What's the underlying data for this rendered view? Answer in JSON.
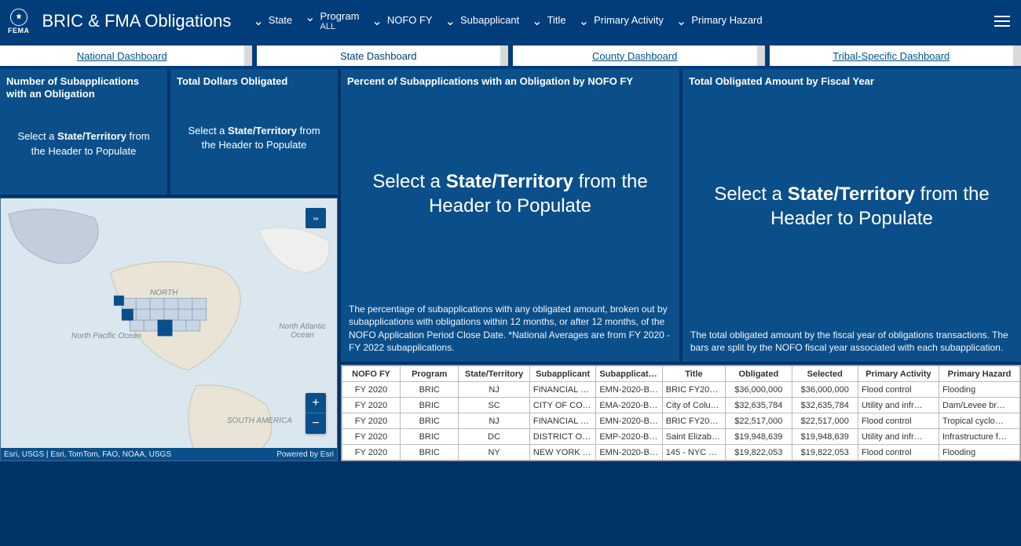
{
  "header": {
    "logo_text": "FEMA",
    "title": "BRIC & FMA Obligations",
    "filters": [
      {
        "label": "State",
        "value": ""
      },
      {
        "label": "Program",
        "value": "ALL"
      },
      {
        "label": "NOFO FY",
        "value": ""
      },
      {
        "label": "Subapplicant",
        "value": ""
      },
      {
        "label": "Title",
        "value": ""
      },
      {
        "label": "Primary Activity",
        "value": ""
      },
      {
        "label": "Primary Hazard",
        "value": ""
      }
    ]
  },
  "tabs": [
    {
      "label": "National Dashboard",
      "active": false
    },
    {
      "label": "State Dashboard",
      "active": true
    },
    {
      "label": "County Dashboard",
      "active": false
    },
    {
      "label": "Tribal-Specific Dashboard",
      "active": false
    }
  ],
  "cards": {
    "num_subapps": {
      "title": "Number of Subapplications with an Obligation",
      "placeholder_pre": "Select a ",
      "placeholder_bold": "State/Territory",
      "placeholder_post": " from the Header to Populate"
    },
    "total_dollars": {
      "title": "Total Dollars Obligated",
      "placeholder_pre": "Select a ",
      "placeholder_bold": "State/Territory",
      "placeholder_post": " from the Header to Populate"
    },
    "percent_nofo": {
      "title": "Percent of Subapplications with an Obligation by NOFO FY",
      "placeholder_pre": "Select a ",
      "placeholder_bold": "State/Territory",
      "placeholder_post": " from the Header to Populate",
      "desc": "The percentage of subapplications with any obligated amount, broken out by subapplications with obligations within 12 months, or after 12 months, of the NOFO Application Period Close Date. *National Averages are from FY 2020 - FY 2022 subapplications."
    },
    "total_by_fy": {
      "title": "Total Obligated Amount by Fiscal Year",
      "placeholder_pre": "Select a ",
      "placeholder_bold": "State/Territory",
      "placeholder_post": " from the Header to Populate",
      "desc": "The total obligated amount by the fiscal year of obligations transactions. The bars are split by the NOFO fiscal year associated with each subapplication."
    }
  },
  "map": {
    "labels": {
      "north_america": "NORTH",
      "south_america": "SOUTH AMERICA",
      "pacific": "North Pacific Ocean",
      "atlantic": "North Atlantic Ocean"
    },
    "attribution_left": "Esri, USGS | Esri, TomTom, FAO, NOAA, USGS",
    "attribution_right": "Powered by Esri"
  },
  "table": {
    "columns": [
      "NOFO FY",
      "Program",
      "State/Territory",
      "Subapplicant",
      "Subapplicatio…",
      "Title",
      "Obligated",
      "Selected",
      "Primary Activity",
      "Primary Hazard"
    ],
    "rows": [
      [
        "FY 2020",
        "BRIC",
        "NJ",
        "FINANCIAL M…",
        "EMN-2020-BR…",
        "BRIC FY2020 …",
        "$36,000,000",
        "$36,000,000",
        "Flood control",
        "Flooding"
      ],
      [
        "FY 2020",
        "BRIC",
        "SC",
        "CITY OF COL…",
        "EMA-2020-BR…",
        "City of Colum…",
        "$32,635,784",
        "$32,635,784",
        "Utility and infr…",
        "Dam/Levee br…"
      ],
      [
        "FY 2020",
        "BRIC",
        "NJ",
        "FINANCIAL M…",
        "EMN-2020-BR…",
        "BRIC FY2020 …",
        "$22,517,000",
        "$22,517,000",
        "Flood control",
        "Tropical cyclo…"
      ],
      [
        "FY 2020",
        "BRIC",
        "DC",
        "DISTRICT OF …",
        "EMP-2020-BR…",
        "Saint Elizabet…",
        "$19,948,639",
        "$19,948,639",
        "Utility and infr…",
        "Infrastructure f…"
      ],
      [
        "FY 2020",
        "BRIC",
        "NY",
        "NEW YORK CI…",
        "EMN-2020-BR…",
        "145 - NYC Par…",
        "$19,822,053",
        "$19,822,053",
        "Flood control",
        "Flooding"
      ]
    ]
  }
}
